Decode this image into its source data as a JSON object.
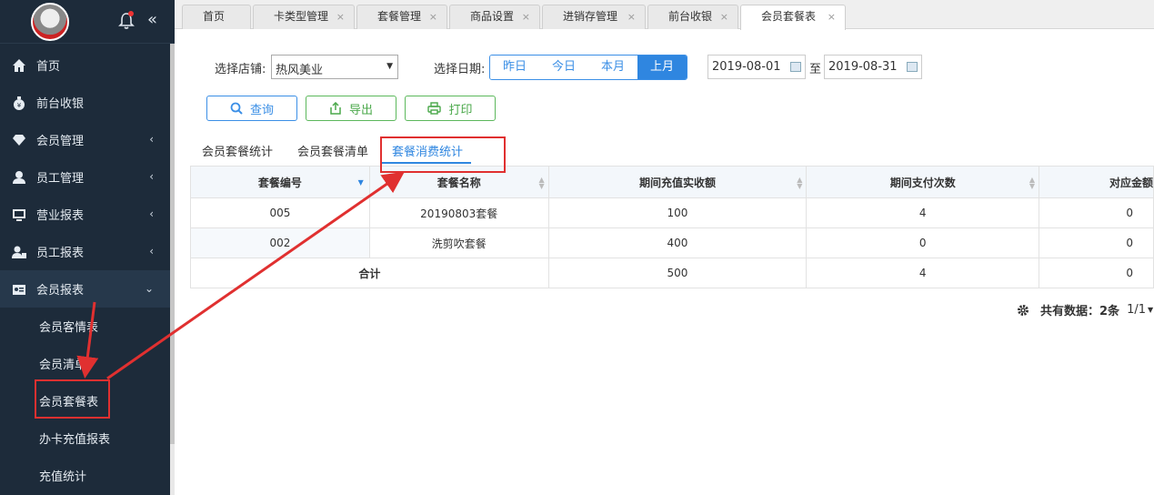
{
  "sidebar": {
    "items": [
      {
        "label": "首页",
        "icon": "home-icon",
        "arrow": ""
      },
      {
        "label": "前台收银",
        "icon": "money-bag-icon",
        "arrow": ""
      },
      {
        "label": "会员管理",
        "icon": "diamond-icon",
        "arrow": "‹"
      },
      {
        "label": "员工管理",
        "icon": "user-icon",
        "arrow": "‹"
      },
      {
        "label": "营业报表",
        "icon": "monitor-icon",
        "arrow": "‹"
      },
      {
        "label": "员工报表",
        "icon": "user-report-icon",
        "arrow": "‹"
      },
      {
        "label": "会员报表",
        "icon": "id-card-icon",
        "arrow": "⌄"
      }
    ],
    "subitems": [
      {
        "label": "会员客情表"
      },
      {
        "label": "会员清单"
      },
      {
        "label": "会员套餐表"
      },
      {
        "label": "办卡充值报表"
      },
      {
        "label": "充值统计"
      }
    ],
    "collapse_glyph": "«"
  },
  "tabs": [
    {
      "label": "首页",
      "close": ""
    },
    {
      "label": "卡类型管理",
      "close": "×"
    },
    {
      "label": "套餐管理",
      "close": "×"
    },
    {
      "label": "商品设置",
      "close": "×"
    },
    {
      "label": "进销存管理",
      "close": "×"
    },
    {
      "label": "前台收银",
      "close": "×"
    },
    {
      "label": "会员套餐表",
      "close": "×"
    }
  ],
  "filters": {
    "store_label": "选择店铺:",
    "store_value": "热风美业",
    "date_label": "选择日期:",
    "ranges": [
      "昨日",
      "今日",
      "本月",
      "上月"
    ],
    "active_range": "上月",
    "start_date": "2019-08-01",
    "to_label": "至",
    "end_date": "2019-08-31"
  },
  "actions": {
    "query": "查询",
    "export": "导出",
    "print": "打印"
  },
  "subtabs": [
    {
      "label": "会员套餐统计"
    },
    {
      "label": "会员套餐清单"
    },
    {
      "label": "套餐消费统计"
    }
  ],
  "table": {
    "columns": [
      "套餐编号",
      "套餐名称",
      "期间充值实收额",
      "期间支付次数",
      "对应金额"
    ],
    "rows": [
      [
        "005",
        "20190803套餐",
        "100",
        "4",
        "0"
      ],
      [
        "002",
        "洗剪吹套餐",
        "400",
        "0",
        "0"
      ]
    ],
    "total": {
      "label": "合计",
      "recharge": "500",
      "count": "4",
      "amount": "0"
    }
  },
  "footer": {
    "prefix": "共有数据：",
    "count": "2条",
    "pages": "1/1"
  },
  "colors": {
    "accent": "#2f86e0",
    "sidebar_bg": "#1d2b3a",
    "annotation_red": "#e03030",
    "export_green": "#4aa84a"
  }
}
